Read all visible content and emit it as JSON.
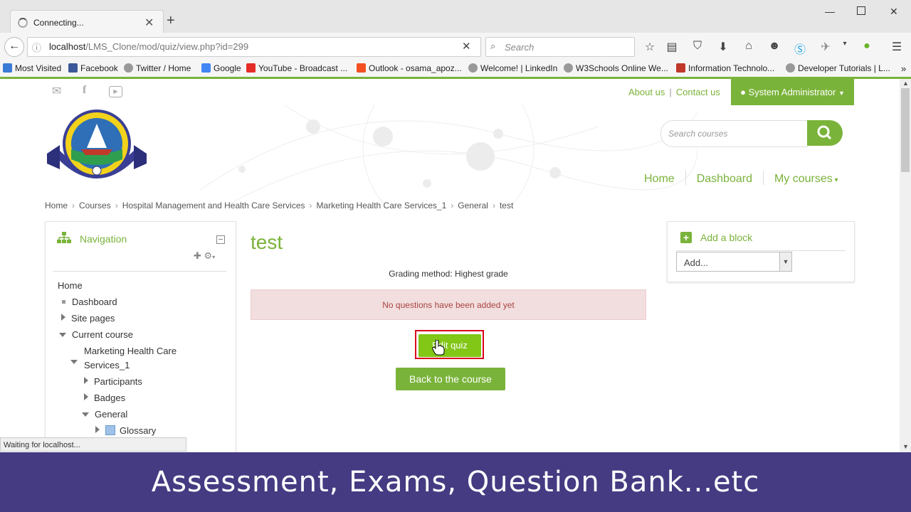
{
  "browser": {
    "tab_title": "Connecting...",
    "url_host": "localhost",
    "url_path": "/LMS_Clone/mod/quiz/view.php?id=299",
    "search_placeholder": "Search",
    "bookmarks": [
      "Most Visited",
      "Facebook",
      "Twitter / Home",
      "Google",
      "YouTube - Broadcast ...",
      "Outlook - osama_apoz...",
      "Welcome! | LinkedIn",
      "W3Schools Online We...",
      "Information Technolo...",
      "Developer Tutorials | L..."
    ],
    "status_text": "Waiting for localhost..."
  },
  "header": {
    "about": "About us",
    "separator": "|",
    "contact": "Contact us",
    "user_menu": "System Administrator",
    "search_placeholder": "Search courses",
    "menu": [
      "Home",
      "Dashboard",
      "My courses"
    ]
  },
  "breadcrumb": [
    "Home",
    "Courses",
    "Hospital Management and Health Care Services",
    "Marketing Health Care Services_1",
    "General",
    "test"
  ],
  "navigation": {
    "title": "Navigation",
    "items": [
      "Home",
      "Dashboard",
      "Site pages",
      "Current course",
      "Marketing Health Care",
      "Services_1",
      "Participants",
      "Badges",
      "General",
      "Glossary"
    ]
  },
  "main": {
    "title": "test",
    "grading": "Grading method: Highest grade",
    "alert": "No questions have been added yet",
    "edit_button": "Edit quiz",
    "back_button": "Back to the course"
  },
  "addblock": {
    "title": "Add a block",
    "select_value": "Add..."
  },
  "caption": "Assessment, Exams, Question Bank...etc",
  "colors": {
    "accent": "#7ab33a",
    "caption_bg": "#453b82",
    "alert_text": "#a94442"
  }
}
